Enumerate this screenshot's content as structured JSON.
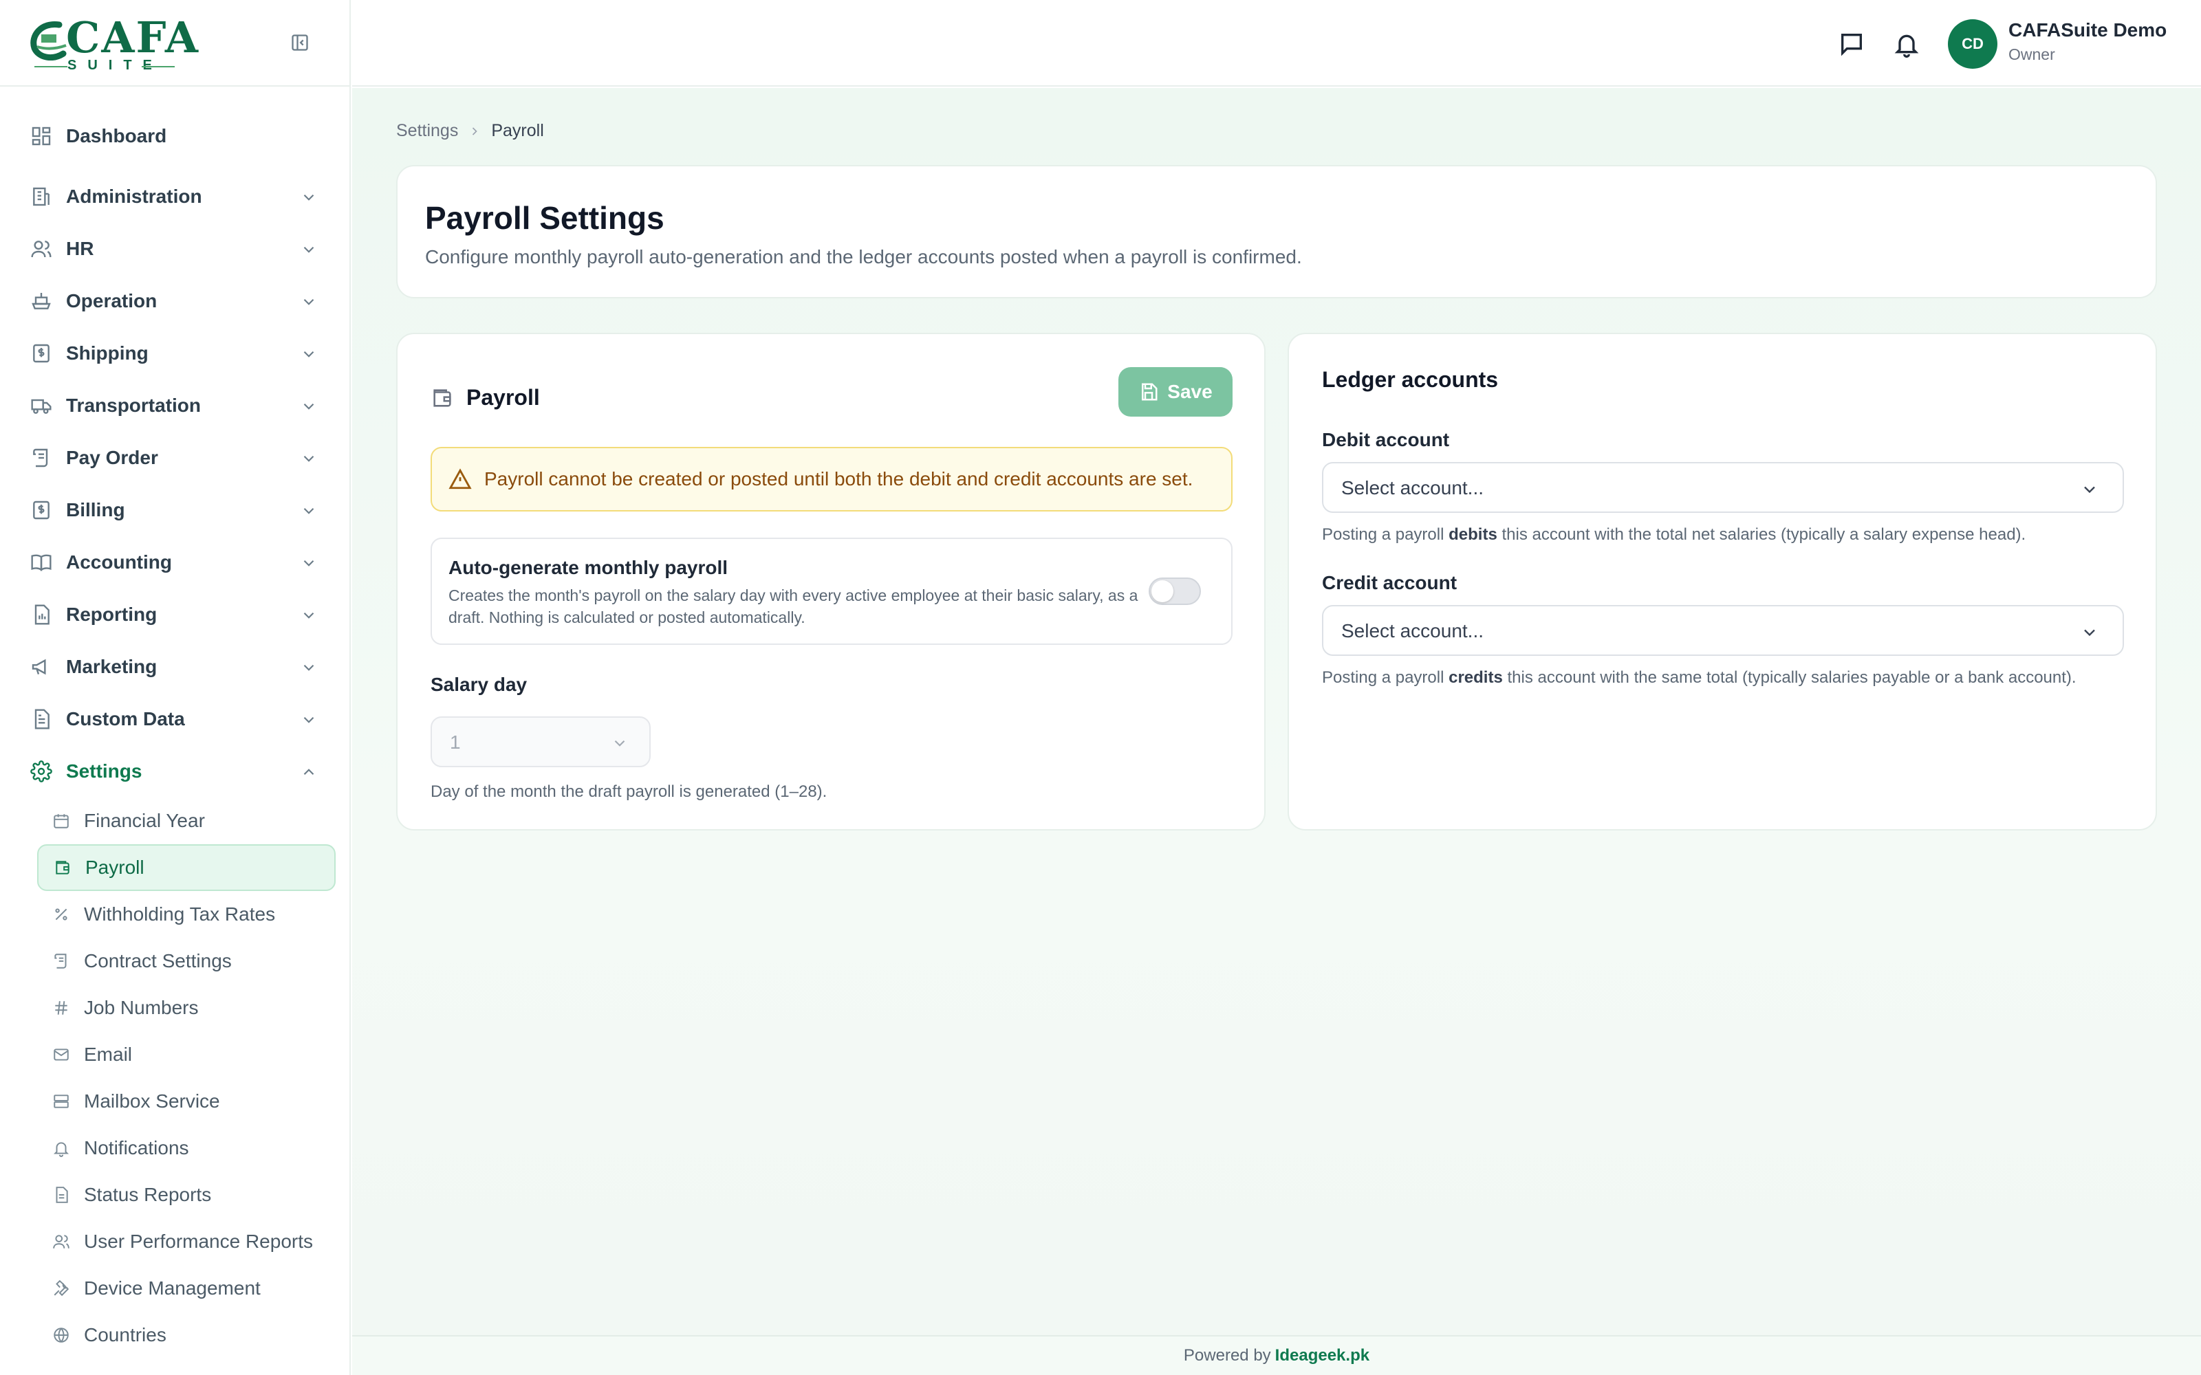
{
  "app": {
    "logo_text": "CAFA",
    "logo_subtext": "SUITE"
  },
  "sidebar": {
    "items": [
      {
        "label": "Dashboard",
        "icon": "dashboard-icon"
      },
      {
        "label": "Administration",
        "icon": "building-icon"
      },
      {
        "label": "HR",
        "icon": "users-icon"
      },
      {
        "label": "Operation",
        "icon": "ship-icon"
      },
      {
        "label": "Shipping",
        "icon": "dollar-doc-icon"
      },
      {
        "label": "Transportation",
        "icon": "truck-icon"
      },
      {
        "label": "Pay Order",
        "icon": "scroll-icon"
      },
      {
        "label": "Billing",
        "icon": "billing-icon"
      },
      {
        "label": "Accounting",
        "icon": "book-icon"
      },
      {
        "label": "Reporting",
        "icon": "report-icon"
      },
      {
        "label": "Marketing",
        "icon": "megaphone-icon"
      },
      {
        "label": "Custom Data",
        "icon": "file-data-icon"
      },
      {
        "label": "Settings",
        "icon": "gear-icon",
        "expanded": true
      }
    ],
    "settings_sub": [
      {
        "label": "Financial Year",
        "icon": "calendar-icon"
      },
      {
        "label": "Payroll",
        "icon": "wallet-icon",
        "active": true
      },
      {
        "label": "Withholding Tax Rates",
        "icon": "percent-icon"
      },
      {
        "label": "Contract Settings",
        "icon": "scroll-icon"
      },
      {
        "label": "Job Numbers",
        "icon": "hash-icon"
      },
      {
        "label": "Email",
        "icon": "mail-icon"
      },
      {
        "label": "Mailbox Service",
        "icon": "server-icon"
      },
      {
        "label": "Notifications",
        "icon": "bell-icon"
      },
      {
        "label": "Status Reports",
        "icon": "file-icon"
      },
      {
        "label": "User Performance Reports",
        "icon": "users-icon"
      },
      {
        "label": "Device Management",
        "icon": "wrench-icon"
      },
      {
        "label": "Countries",
        "icon": "globe-icon"
      }
    ]
  },
  "topbar": {
    "avatar_initials": "CD",
    "user_name": "CAFASuite Demo",
    "user_role": "Owner"
  },
  "breadcrumb": {
    "parent": "Settings",
    "current": "Payroll"
  },
  "page": {
    "title": "Payroll Settings",
    "description": "Configure monthly payroll auto-generation and the ledger accounts posted when a payroll is confirmed."
  },
  "payroll_card": {
    "title": "Payroll",
    "save_label": "Save",
    "alert": "Payroll cannot be created or posted until both the debit and credit accounts are set.",
    "auto_generate_title": "Auto-generate monthly payroll",
    "auto_generate_desc": "Creates the month's payroll on the salary day with every active employee at their basic salary, as a draft. Nothing is calculated or posted automatically.",
    "auto_generate_enabled": false,
    "salary_day_label": "Salary day",
    "salary_day_value": "1",
    "salary_day_hint": "Day of the month the draft payroll is generated (1–28)."
  },
  "ledger_card": {
    "title": "Ledger accounts",
    "debit_label": "Debit account",
    "debit_placeholder": "Select account...",
    "debit_hint_pre": "Posting a payroll ",
    "debit_hint_bold": "debits",
    "debit_hint_post": " this account with the total net salaries (typically a salary expense head).",
    "credit_label": "Credit account",
    "credit_placeholder": "Select account...",
    "credit_hint_pre": "Posting a payroll ",
    "credit_hint_bold": "credits",
    "credit_hint_post": " this account with the same total (typically salaries payable or a bank account)."
  },
  "footer": {
    "prefix": "Powered by",
    "brand": "Ideageek.pk"
  },
  "colors": {
    "brand": "#0f7a4f",
    "save_button": "#7cc4a1",
    "alert_bg": "#fefbe8",
    "alert_text": "#8a4b0c"
  }
}
